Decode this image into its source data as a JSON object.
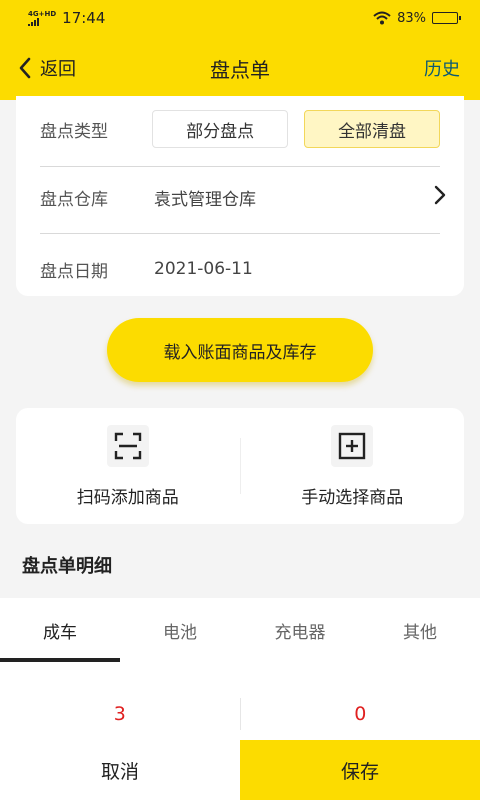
{
  "status_bar": {
    "network": "4G+HD",
    "time": "17:44",
    "battery": "83%",
    "battery_level": 0.83
  },
  "navbar": {
    "back_label": "返回",
    "title": "盘点单",
    "history_label": "历史"
  },
  "form": {
    "type_label": "盘点类型",
    "type_options": [
      "部分盘点",
      "全部清盘"
    ],
    "type_selected": "全部清盘",
    "warehouse_label": "盘点仓库",
    "warehouse_value": "袁式管理仓库",
    "date_label": "盘点日期",
    "date_value": "2021-06-11"
  },
  "load_button": "载入账面商品及库存",
  "actions": {
    "scan": "扫码添加商品",
    "manual": "手动选择商品"
  },
  "section_title": "盘点单明细",
  "tabs": [
    "成车",
    "电池",
    "充电器",
    "其他"
  ],
  "active_tab": "成车",
  "summary": {
    "left_count": "3",
    "right_count": "0"
  },
  "bottom": {
    "cancel": "取消",
    "save": "保存"
  },
  "colors": {
    "accent": "#FCDC00",
    "count": "#e02020",
    "history": "#0b5a74"
  },
  "icons": {
    "scan": "scan-icon",
    "add": "plus-square-icon",
    "back": "chevron-left-icon",
    "more": "chevron-right-icon"
  }
}
